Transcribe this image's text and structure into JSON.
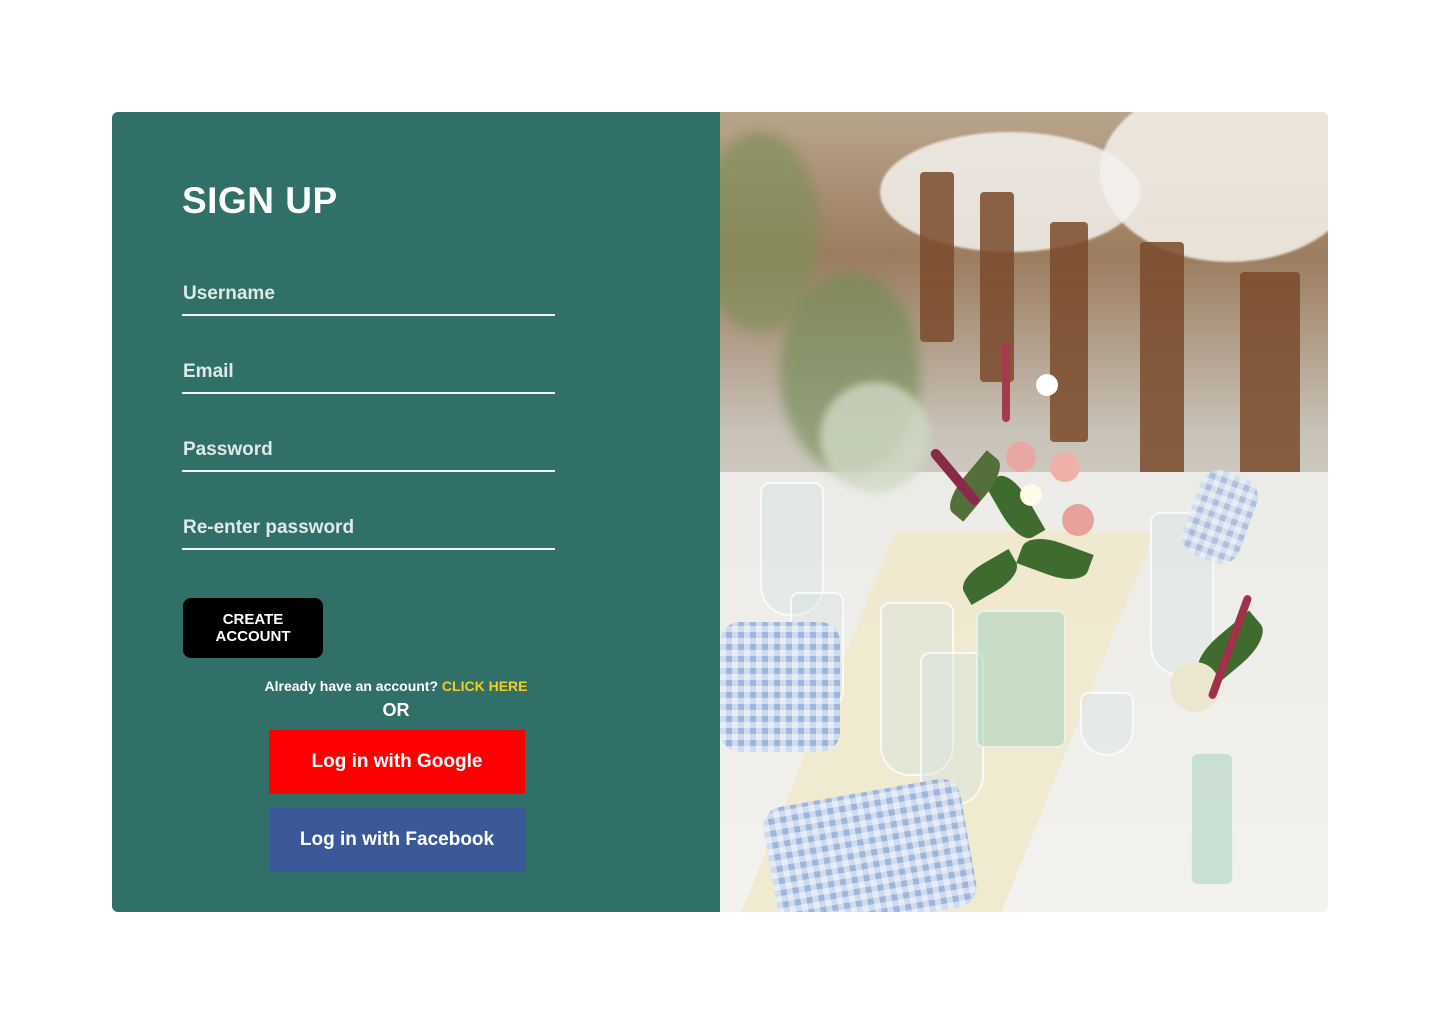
{
  "signup": {
    "title": "SIGN UP",
    "fields": {
      "username_placeholder": "Username",
      "email_placeholder": "Email",
      "password_placeholder": "Password",
      "reenter_placeholder": "Re-enter password"
    },
    "create_button": "CREATE ACCOUNT",
    "already_text": "Already have an account?",
    "login_link": "CLICK HERE",
    "or_text": "OR",
    "google_button": "Log in with Google",
    "facebook_button": "Log in with Facebook"
  },
  "colors": {
    "panel": "#316f69",
    "create_button": "#000000",
    "link": "#f2cf1d",
    "google": "#ff0000",
    "facebook": "#3b5998"
  },
  "icons": {
    "hero": "wedding-table-photo"
  }
}
